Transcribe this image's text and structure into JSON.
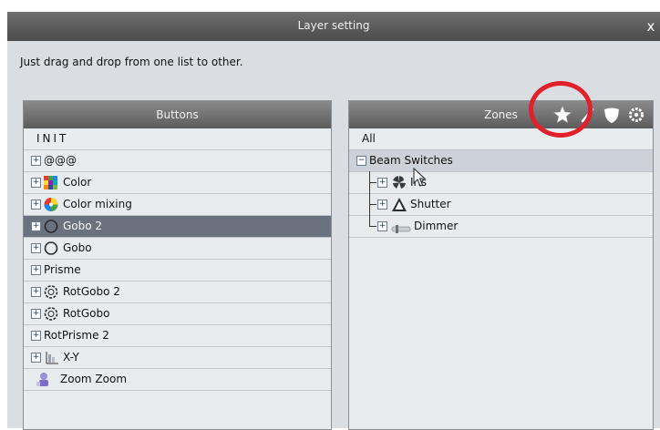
{
  "window": {
    "title": "Layer setting",
    "close_label": "x"
  },
  "instruction": "Just drag and drop from one list to other.",
  "buttons_panel": {
    "header": "Buttons",
    "items": [
      {
        "label": "INIT"
      },
      {
        "label": "@@@"
      },
      {
        "label": "Color",
        "icon": "color-grid-icon"
      },
      {
        "label": "Color mixing",
        "icon": "color-wheel-icon"
      },
      {
        "label": "Gobo 2",
        "icon": "gobo-ring-icon",
        "selected": true
      },
      {
        "label": "Gobo",
        "icon": "gobo-ring-icon"
      },
      {
        "label": "Prisme"
      },
      {
        "label": "RotGobo 2",
        "icon": "rotgobo-icon"
      },
      {
        "label": "RotGobo",
        "icon": "rotgobo-icon"
      },
      {
        "label": "RotPrisme 2"
      },
      {
        "label": "X-Y",
        "icon": "xy-icon"
      },
      {
        "label": "Zoom Zoom",
        "icon": "zoom-figure-icon"
      }
    ]
  },
  "zones_panel": {
    "header": "Zones",
    "toolbar_icons": [
      "star-icon",
      "wand-icon",
      "shield-icon",
      "gear-icon"
    ],
    "items": [
      {
        "label": "All"
      },
      {
        "label": "Beam Switches",
        "expanded": true
      },
      {
        "label": "Iris",
        "icon": "iris-icon"
      },
      {
        "label": "Shutter",
        "icon": "shutter-icon"
      },
      {
        "label": "Dimmer",
        "icon": "dimmer-icon"
      }
    ]
  },
  "colors": {
    "selected_row": "#6a7280",
    "annotation": "#e0202a"
  }
}
